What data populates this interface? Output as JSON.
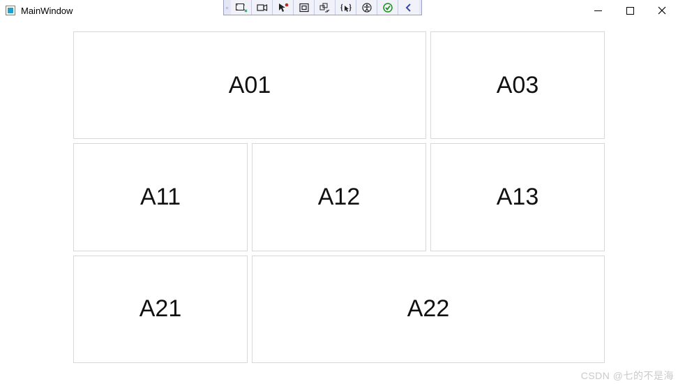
{
  "window": {
    "title": "MainWindow"
  },
  "toolbar": {
    "items": [
      "select-tool-icon",
      "camera-icon",
      "cursor-record-icon",
      "square-icon",
      "arrange-icon",
      "curly-cursor-icon",
      "accessibility-icon",
      "check-circle-icon",
      "chevron-left-icon"
    ]
  },
  "grid": {
    "rows": [
      [
        {
          "label": "A01",
          "colspan": 2
        },
        {
          "label": "A03",
          "colspan": 1
        }
      ],
      [
        {
          "label": "A11",
          "colspan": 1
        },
        {
          "label": "A12",
          "colspan": 1
        },
        {
          "label": "A13",
          "colspan": 1
        }
      ],
      [
        {
          "label": "A21",
          "colspan": 1
        },
        {
          "label": "A22",
          "colspan": 2
        }
      ]
    ]
  },
  "watermark": "CSDN @七的不是海"
}
